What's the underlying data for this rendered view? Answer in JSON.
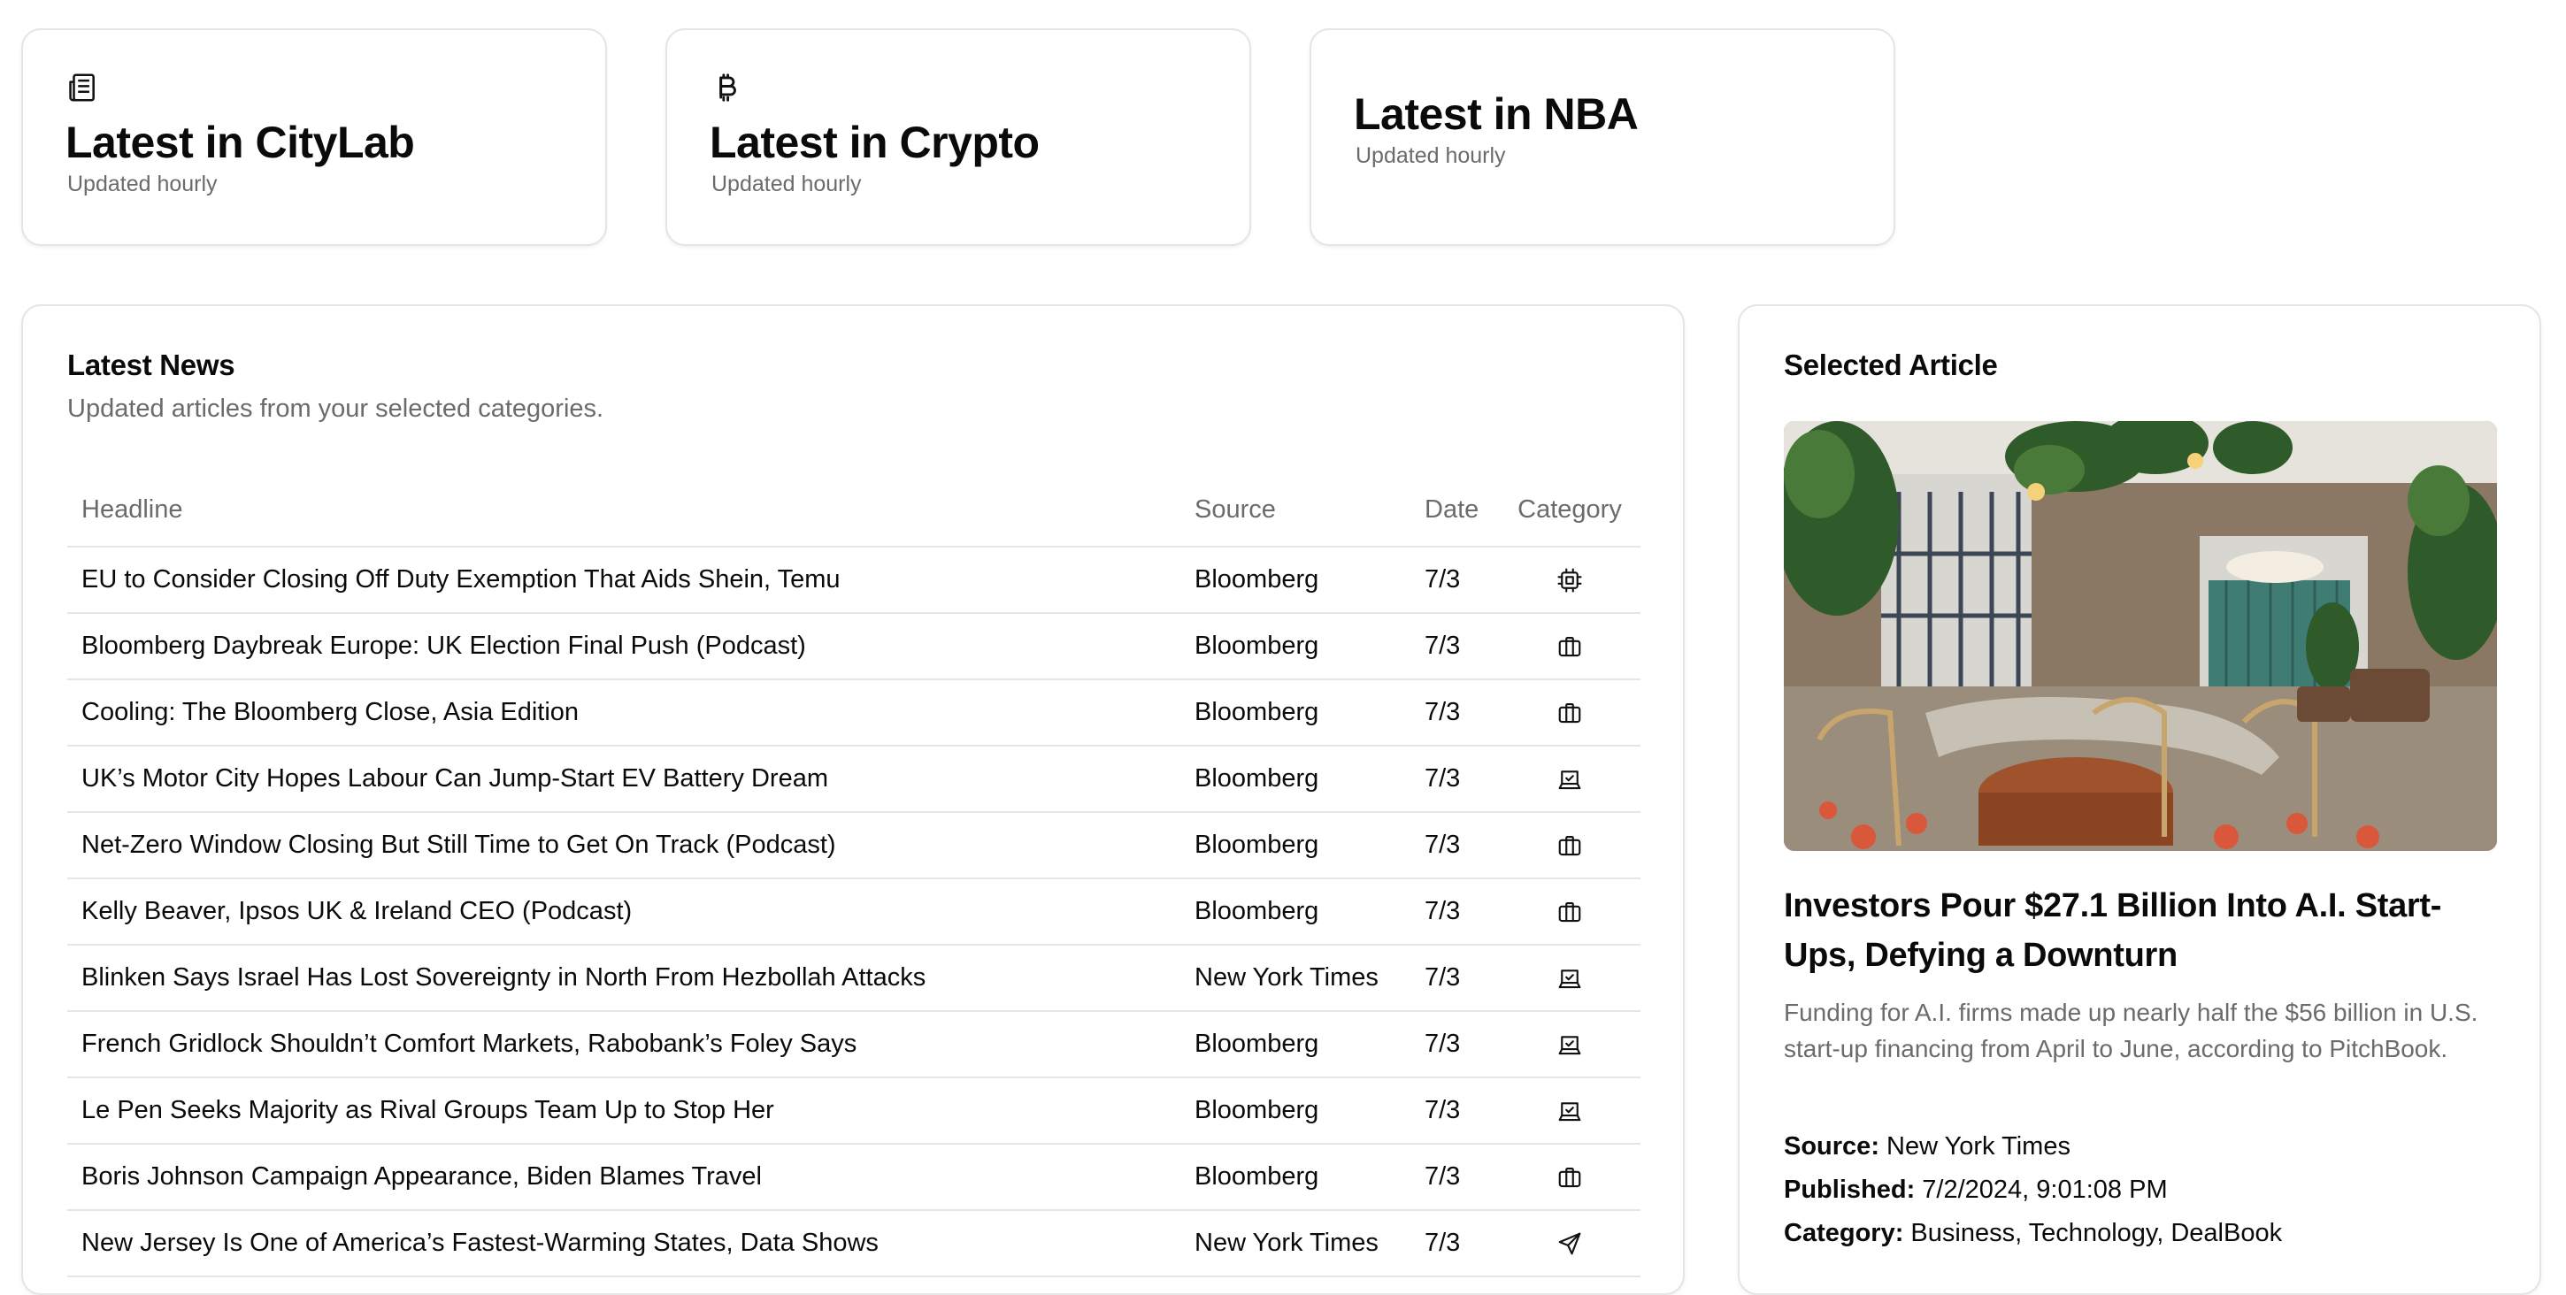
{
  "topics": [
    {
      "title": "Latest in CityLab",
      "subtitle": "Updated hourly",
      "icon": "newspaper-icon"
    },
    {
      "title": "Latest in Crypto",
      "subtitle": "Updated hourly",
      "icon": "bitcoin-icon"
    },
    {
      "title": "Latest in NBA",
      "subtitle": "Updated hourly",
      "icon": ""
    }
  ],
  "news": {
    "title": "Latest News",
    "description": "Updated articles from your selected categories.",
    "columns": {
      "headline": "Headline",
      "source": "Source",
      "date": "Date",
      "category": "Category"
    },
    "rows": [
      {
        "headline": "EU to Consider Closing Off Duty Exemption That Aids Shein, Temu",
        "source": "Bloomberg",
        "date": "7/3",
        "category_icon": "cpu-chip-icon"
      },
      {
        "headline": "Bloomberg Daybreak Europe: UK Election Final Push (Podcast)",
        "source": "Bloomberg",
        "date": "7/3",
        "category_icon": "briefcase-icon"
      },
      {
        "headline": "Cooling: The Bloomberg Close, Asia Edition",
        "source": "Bloomberg",
        "date": "7/3",
        "category_icon": "briefcase-icon"
      },
      {
        "headline": "UK’s Motor City Hopes Labour Can Jump-Start EV Battery Dream",
        "source": "Bloomberg",
        "date": "7/3",
        "category_icon": "ballot-box-icon"
      },
      {
        "headline": "Net-Zero Window Closing But Still Time to Get On Track (Podcast)",
        "source": "Bloomberg",
        "date": "7/3",
        "category_icon": "briefcase-icon"
      },
      {
        "headline": "Kelly Beaver, Ipsos UK & Ireland CEO (Podcast)",
        "source": "Bloomberg",
        "date": "7/3",
        "category_icon": "briefcase-icon"
      },
      {
        "headline": "Blinken Says Israel Has Lost Sovereignty in North From Hezbollah Attacks",
        "source": "New York Times",
        "date": "7/3",
        "category_icon": "ballot-box-icon"
      },
      {
        "headline": "French Gridlock Shouldn’t Comfort Markets, Rabobank’s Foley Says",
        "source": "Bloomberg",
        "date": "7/3",
        "category_icon": "ballot-box-icon"
      },
      {
        "headline": "Le Pen Seeks Majority as Rival Groups Team Up to Stop Her",
        "source": "Bloomberg",
        "date": "7/3",
        "category_icon": "ballot-box-icon"
      },
      {
        "headline": "Boris Johnson Campaign Appearance, Biden Blames Travel",
        "source": "Bloomberg",
        "date": "7/3",
        "category_icon": "briefcase-icon"
      },
      {
        "headline": "New Jersey Is One of America’s Fastest-Warming States, Data Shows",
        "source": "New York Times",
        "date": "7/3",
        "category_icon": "send-arrow-icon"
      }
    ]
  },
  "article": {
    "panel_title": "Selected Article",
    "title": "Investors Pour $27.1 Billion Into A.I. Start-Ups, Defying a Downturn",
    "summary": "Funding for A.I. firms made up nearly half the $56 billion in U.S. start-up financing from April to June, according to PitchBook.",
    "source_label": "Source:",
    "source": "New York Times",
    "published_label": "Published:",
    "published": "7/2/2024, 9:01:08 PM",
    "category_label": "Category:",
    "category": "Business, Technology, DealBook"
  }
}
